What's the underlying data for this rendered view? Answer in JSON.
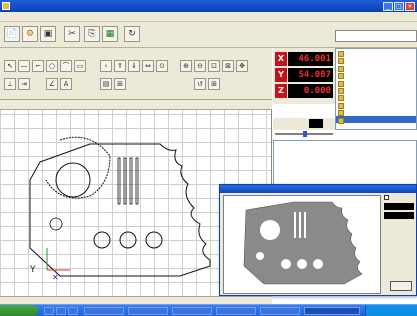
{
  "window": {
    "title": "",
    "controls": [
      "_",
      "□",
      "×"
    ]
  },
  "menu": [
    "",
    "",
    "",
    "",
    "",
    "",
    "",
    "",
    "",
    ""
  ],
  "toolbar": {
    "icons": [
      "new-file-icon",
      "open-icon",
      "save-icon",
      "cut-icon",
      "copy-icon",
      "paste-icon",
      "preview-icon",
      "print-icon",
      "settings-icon"
    ],
    "labels": [
      "",
      "",
      "",
      "",
      "",
      "",
      ""
    ]
  },
  "coord_box": "",
  "dro": {
    "x_label": "X",
    "x_value": "46.001",
    "y_label": "Y",
    "y_value": "54.087",
    "z_label": "Z",
    "z_value": "0.000"
  },
  "tabs": {
    "left1": "",
    "left2": "",
    "view": ""
  },
  "right_list": [
    "",
    "",
    "",
    "",
    "",
    "",
    "",
    "",
    "",
    ""
  ],
  "speed": {
    "label": "",
    "value": ""
  },
  "info_lines": [
    "",
    "",
    "",
    "",
    "",
    ""
  ],
  "preview": {
    "title": "",
    "checkbox_label": "",
    "ok_button": ""
  },
  "status_text": "",
  "taskbar": {
    "start_label": "",
    "tray_text": ""
  },
  "colors": {
    "axis_red": "#c3131b",
    "dro_bg": "#000000",
    "dro_text": "#ff2a2a",
    "selection": "#316ac5",
    "window_chrome": "#ece9d8",
    "title_blue": "#0a3fb5"
  }
}
